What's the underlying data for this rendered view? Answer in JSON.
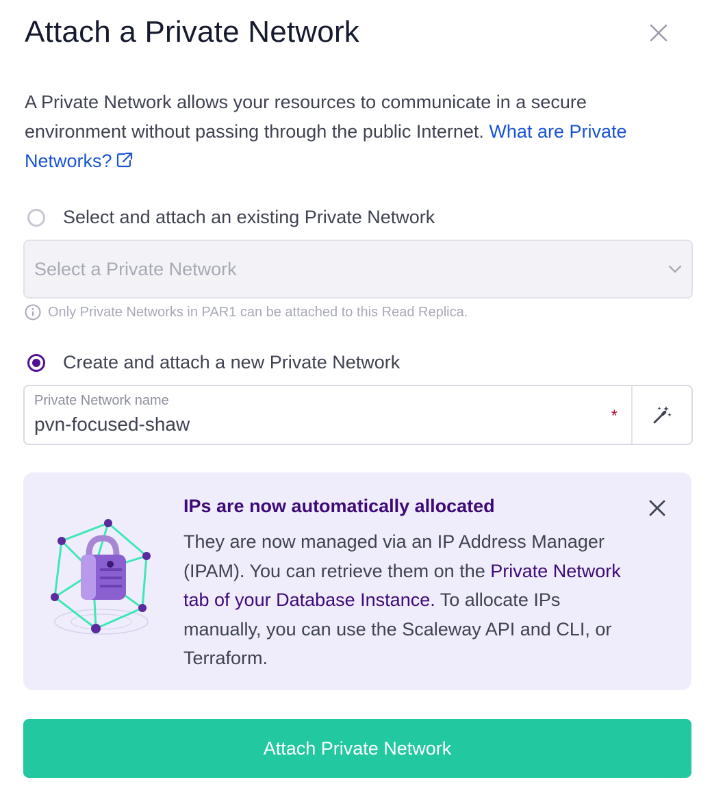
{
  "dialog": {
    "title": "Attach a Private Network",
    "close_icon": "close-icon"
  },
  "description": {
    "text": "A Private Network allows your resources to communicate in a secure environment without passing through the public Internet. ",
    "link_label": "What are Private Networks?",
    "link_icon": "external-link-icon"
  },
  "options": {
    "existing": {
      "label": "Select and attach an existing Private Network",
      "checked": false,
      "select_placeholder": "Select a Private Network",
      "helper_text": "Only Private Networks in PAR1 can be attached to this Read Replica."
    },
    "new": {
      "label": "Create and attach a new Private Network",
      "checked": true,
      "field_label": "Private Network name",
      "field_value": "pvn-focused-shaw",
      "required_mark": "*",
      "generate_icon": "magic-wand-icon"
    }
  },
  "alert": {
    "title": "IPs are now automatically allocated",
    "text_before": "They are now managed via an IP Address Manager (IPAM). You can retrieve them on the ",
    "link_label": "Private Network tab of your Database Instance.",
    "text_after": " To allocate IPs manually, you can use the Scaleway API and CLI, or Terraform.",
    "illustration": "network-lock-illustration"
  },
  "submit_label": "Attach Private Network",
  "colors": {
    "primary": "#521094",
    "link": "#1853d6",
    "alert_bg": "#efedfb",
    "alert_accent": "#3d0a78",
    "submit_bg": "#22c8a0",
    "required": "#b2123b"
  }
}
